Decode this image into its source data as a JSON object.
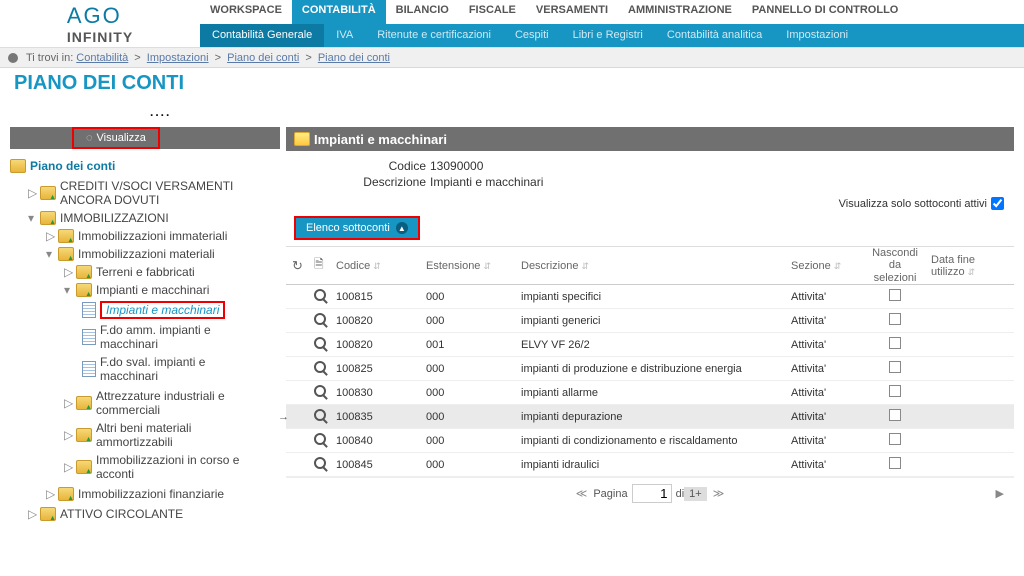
{
  "logo": {
    "line1": "AGO",
    "line2": "INFINITY"
  },
  "main_nav": [
    "WORKSPACE",
    "CONTABILITÀ",
    "BILANCIO",
    "FISCALE",
    "VERSAMENTI",
    "AMMINISTRAZIONE",
    "PANNELLO DI CONTROLLO"
  ],
  "main_nav_active": 1,
  "sub_nav": [
    "Contabilità Generale",
    "IVA",
    "Ritenute e certificazioni",
    "Cespiti",
    "Libri e Registri",
    "Contabilità analitica",
    "Impostazioni"
  ],
  "sub_nav_active": 0,
  "breadcrumb": {
    "prefix": "Ti trovi in:",
    "items": [
      "Contabilità",
      "Impostazioni",
      "Piano dei conti",
      "Piano dei conti"
    ]
  },
  "page_title": "PIANO DEI CONTI",
  "visualizza_label": "Visualizza",
  "tree": {
    "root": "Piano dei conti",
    "n0": "CREDITI V/SOCI VERSAMENTI ANCORA DOVUTI",
    "n1": "IMMOBILIZZAZIONI",
    "n1_0": "Immobilizzazioni immateriali",
    "n1_1": "Immobilizzazioni materiali",
    "n1_1_0": "Terreni e fabbricati",
    "n1_1_1": "Impianti e macchinari",
    "n1_1_1_0": "Impianti e macchinari",
    "n1_1_1_1": "F.do amm. impianti e macchinari",
    "n1_1_1_2": "F.do sval. impianti e macchinari",
    "n1_1_2": "Attrezzature industriali e commerciali",
    "n1_1_3": "Altri beni materiali ammortizzabili",
    "n1_1_4": "Immobilizzazioni in corso e acconti",
    "n1_2": "Immobilizzazioni finanziarie",
    "n2": "ATTIVO CIRCOLANTE"
  },
  "panel": {
    "title": "Impianti e macchinari",
    "codice_label": "Codice",
    "codice_value": "13090000",
    "descrizione_label": "Descrizione",
    "descrizione_value": "Impianti e macchinari",
    "filter_label": "Visualizza solo sottoconti attivi",
    "elenco_label": "Elenco sottoconti"
  },
  "grid": {
    "headers": {
      "codice": "Codice",
      "estensione": "Estensione",
      "descrizione": "Descrizione",
      "sezione": "Sezione",
      "nascondi": "Nascondi da selezioni",
      "data_fine": "Data fine utilizzo"
    },
    "rows": [
      {
        "codice": "100815",
        "est": "000",
        "desc": "impianti specifici",
        "sez": "Attivita'"
      },
      {
        "codice": "100820",
        "est": "000",
        "desc": "impianti generici",
        "sez": "Attivita'"
      },
      {
        "codice": "100820",
        "est": "001",
        "desc": "ELVY VF 26/2",
        "sez": "Attivita'"
      },
      {
        "codice": "100825",
        "est": "000",
        "desc": "impianti di produzione e distribuzione energia",
        "sez": "Attivita'"
      },
      {
        "codice": "100830",
        "est": "000",
        "desc": "impianti allarme",
        "sez": "Attivita'"
      },
      {
        "codice": "100835",
        "est": "000",
        "desc": "impianti depurazione",
        "sez": "Attivita'",
        "current": true
      },
      {
        "codice": "100840",
        "est": "000",
        "desc": "impianti di condizionamento e riscaldamento",
        "sez": "Attivita'"
      },
      {
        "codice": "100845",
        "est": "000",
        "desc": "impianti idraulici",
        "sez": "Attivita'"
      }
    ]
  },
  "pager": {
    "label": "Pagina",
    "current": "1",
    "of_label": "di",
    "total": "1+"
  }
}
